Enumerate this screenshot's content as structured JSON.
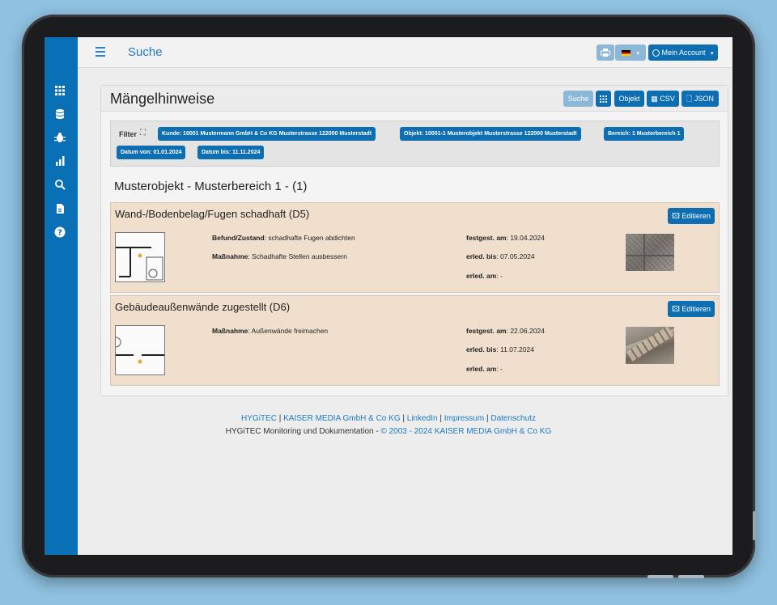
{
  "topbar": {
    "page_link": "Suche",
    "account_label": "Mein Account",
    "language_flag": "de-flag-icon"
  },
  "sidebar": {
    "icons": [
      "grid-icon",
      "database-icon",
      "bug-icon",
      "bar-chart-icon",
      "search-icon",
      "file-icon",
      "help-icon"
    ]
  },
  "card": {
    "title": "Mängelhinweise",
    "buttons": {
      "suche": "Suche",
      "objekt": "Objekt",
      "csv": "CSV",
      "json": "JSON"
    }
  },
  "filter": {
    "label": "Filter",
    "chips": [
      "Kunde: 10001 Mustermann GmbH & Co KG Musterstrasse 122000 Musterstadt",
      "Objekt: 10001-1 Musterobjekt Musterstrasse 122000 Musterstadt",
      "Bereich: 1 Musterbereich 1",
      "Datum von: 01.01.2024",
      "Datum bis: 11.11.2024"
    ]
  },
  "section_title": "Musterobjekt - Musterbereich 1 - (1)",
  "defects": [
    {
      "title": "Wand-/Bodenbelag/Fugen schadhaft (D5)",
      "edit_label": "Editieren",
      "befund_label": "Befund/Zustand",
      "befund_value": ": schadhafte Fugen abdichten",
      "massnahme_label": "Maßnahme",
      "massnahme_value": ": Schadhafte Stellen ausbessern",
      "festgest_label": "festgest. am",
      "festgest_value": ": 19.04.2024",
      "erled_bis_label": "erled. bis",
      "erled_bis_value": ": 07.05.2024",
      "erled_am_label": "erled. am",
      "erled_am_value": ": -"
    },
    {
      "title": "Gebäudeaußenwände zugestellt (D6)",
      "edit_label": "Editieren",
      "massnahme_label": "Maßnahme",
      "massnahme_value": ": Außenwände freimachen",
      "festgest_label": "festgest. am",
      "festgest_value": ": 22.06.2024",
      "erled_bis_label": "erled. bis",
      "erled_bis_value": ": 11.07.2024",
      "erled_am_label": "erled. am",
      "erled_am_value": ": -"
    }
  ],
  "footer": {
    "links": [
      "HYGiTEC",
      "KAISER MEDIA GmbH & Co KG",
      "LinkedIn",
      "Impressum",
      "Datenschutz"
    ],
    "separator": "|",
    "text": "HYGiTEC Monitoring und Dokumentation - ",
    "copyright": "© 2003 - 2024 KAISER MEDIA GmbH & Co KG"
  }
}
